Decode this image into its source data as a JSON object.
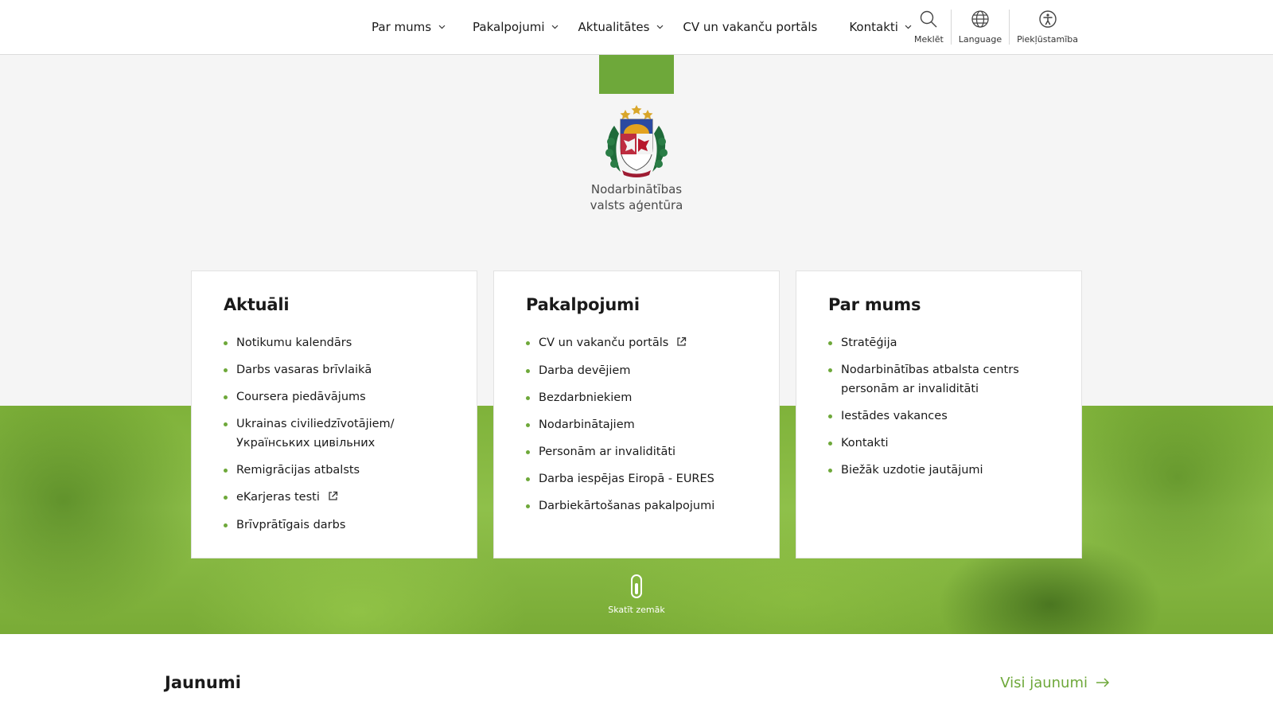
{
  "header": {
    "nav": [
      {
        "label": "Par mums",
        "has_dropdown": true
      },
      {
        "label": "Pakalpojumi",
        "has_dropdown": true
      },
      {
        "label": "Aktualitātes",
        "has_dropdown": true
      },
      {
        "label": "CV un vakanču portāls",
        "has_dropdown": false
      },
      {
        "label": "Kontakti",
        "has_dropdown": true
      }
    ],
    "tools": [
      {
        "label": "Meklēt",
        "icon": "search-icon"
      },
      {
        "label": "Language",
        "icon": "globe-icon"
      },
      {
        "label": "Piekļūstamība",
        "icon": "accessibility-icon"
      }
    ]
  },
  "logo": {
    "line1": "Nodarbinātības",
    "line2": "valsts aģentūra",
    "emblem": "coat-of-arms-of-latvia"
  },
  "cards": [
    {
      "title": "Aktuāli",
      "items": [
        {
          "label": "Notikumu kalendārs",
          "external": false
        },
        {
          "label": "Darbs vasaras brīvlaikā",
          "external": false
        },
        {
          "label": "Coursera piedāvājums",
          "external": false
        },
        {
          "label": "Ukrainas civiliedzīvotājiem/ Українських цивільних",
          "external": false
        },
        {
          "label": "Remigrācijas atbalsts",
          "external": false
        },
        {
          "label": "eKarjeras testi",
          "external": true
        },
        {
          "label": "Brīvprātīgais darbs",
          "external": false
        }
      ]
    },
    {
      "title": "Pakalpojumi",
      "items": [
        {
          "label": "CV un vakanču portāls",
          "external": true
        },
        {
          "label": "Darba devējiem",
          "external": false
        },
        {
          "label": "Bezdarbniekiem",
          "external": false
        },
        {
          "label": "Nodarbinātajiem",
          "external": false
        },
        {
          "label": "Personām ar invaliditāti",
          "external": false
        },
        {
          "label": "Darba iespējas Eiropā - EURES",
          "external": false
        },
        {
          "label": "Darbiekārtošanas pakalpojumi",
          "external": false
        }
      ]
    },
    {
      "title": "Par mums",
      "items": [
        {
          "label": "Stratēģija",
          "external": false
        },
        {
          "label": "Nodarbinātības atbalsta centrs personām ar invaliditāti",
          "external": false
        },
        {
          "label": "Iestādes vakances",
          "external": false
        },
        {
          "label": "Kontakti",
          "external": false
        },
        {
          "label": "Biežāk uzdotie jautājumi",
          "external": false
        }
      ]
    }
  ],
  "scroll_hint": {
    "label": "Skatīt zemāk"
  },
  "news": {
    "title": "Jaunumi",
    "all_link": "Visi jaunumi"
  },
  "colors": {
    "accent": "#6ea83a",
    "background_grey": "#f5f5f5",
    "text": "#1a1a1a"
  }
}
